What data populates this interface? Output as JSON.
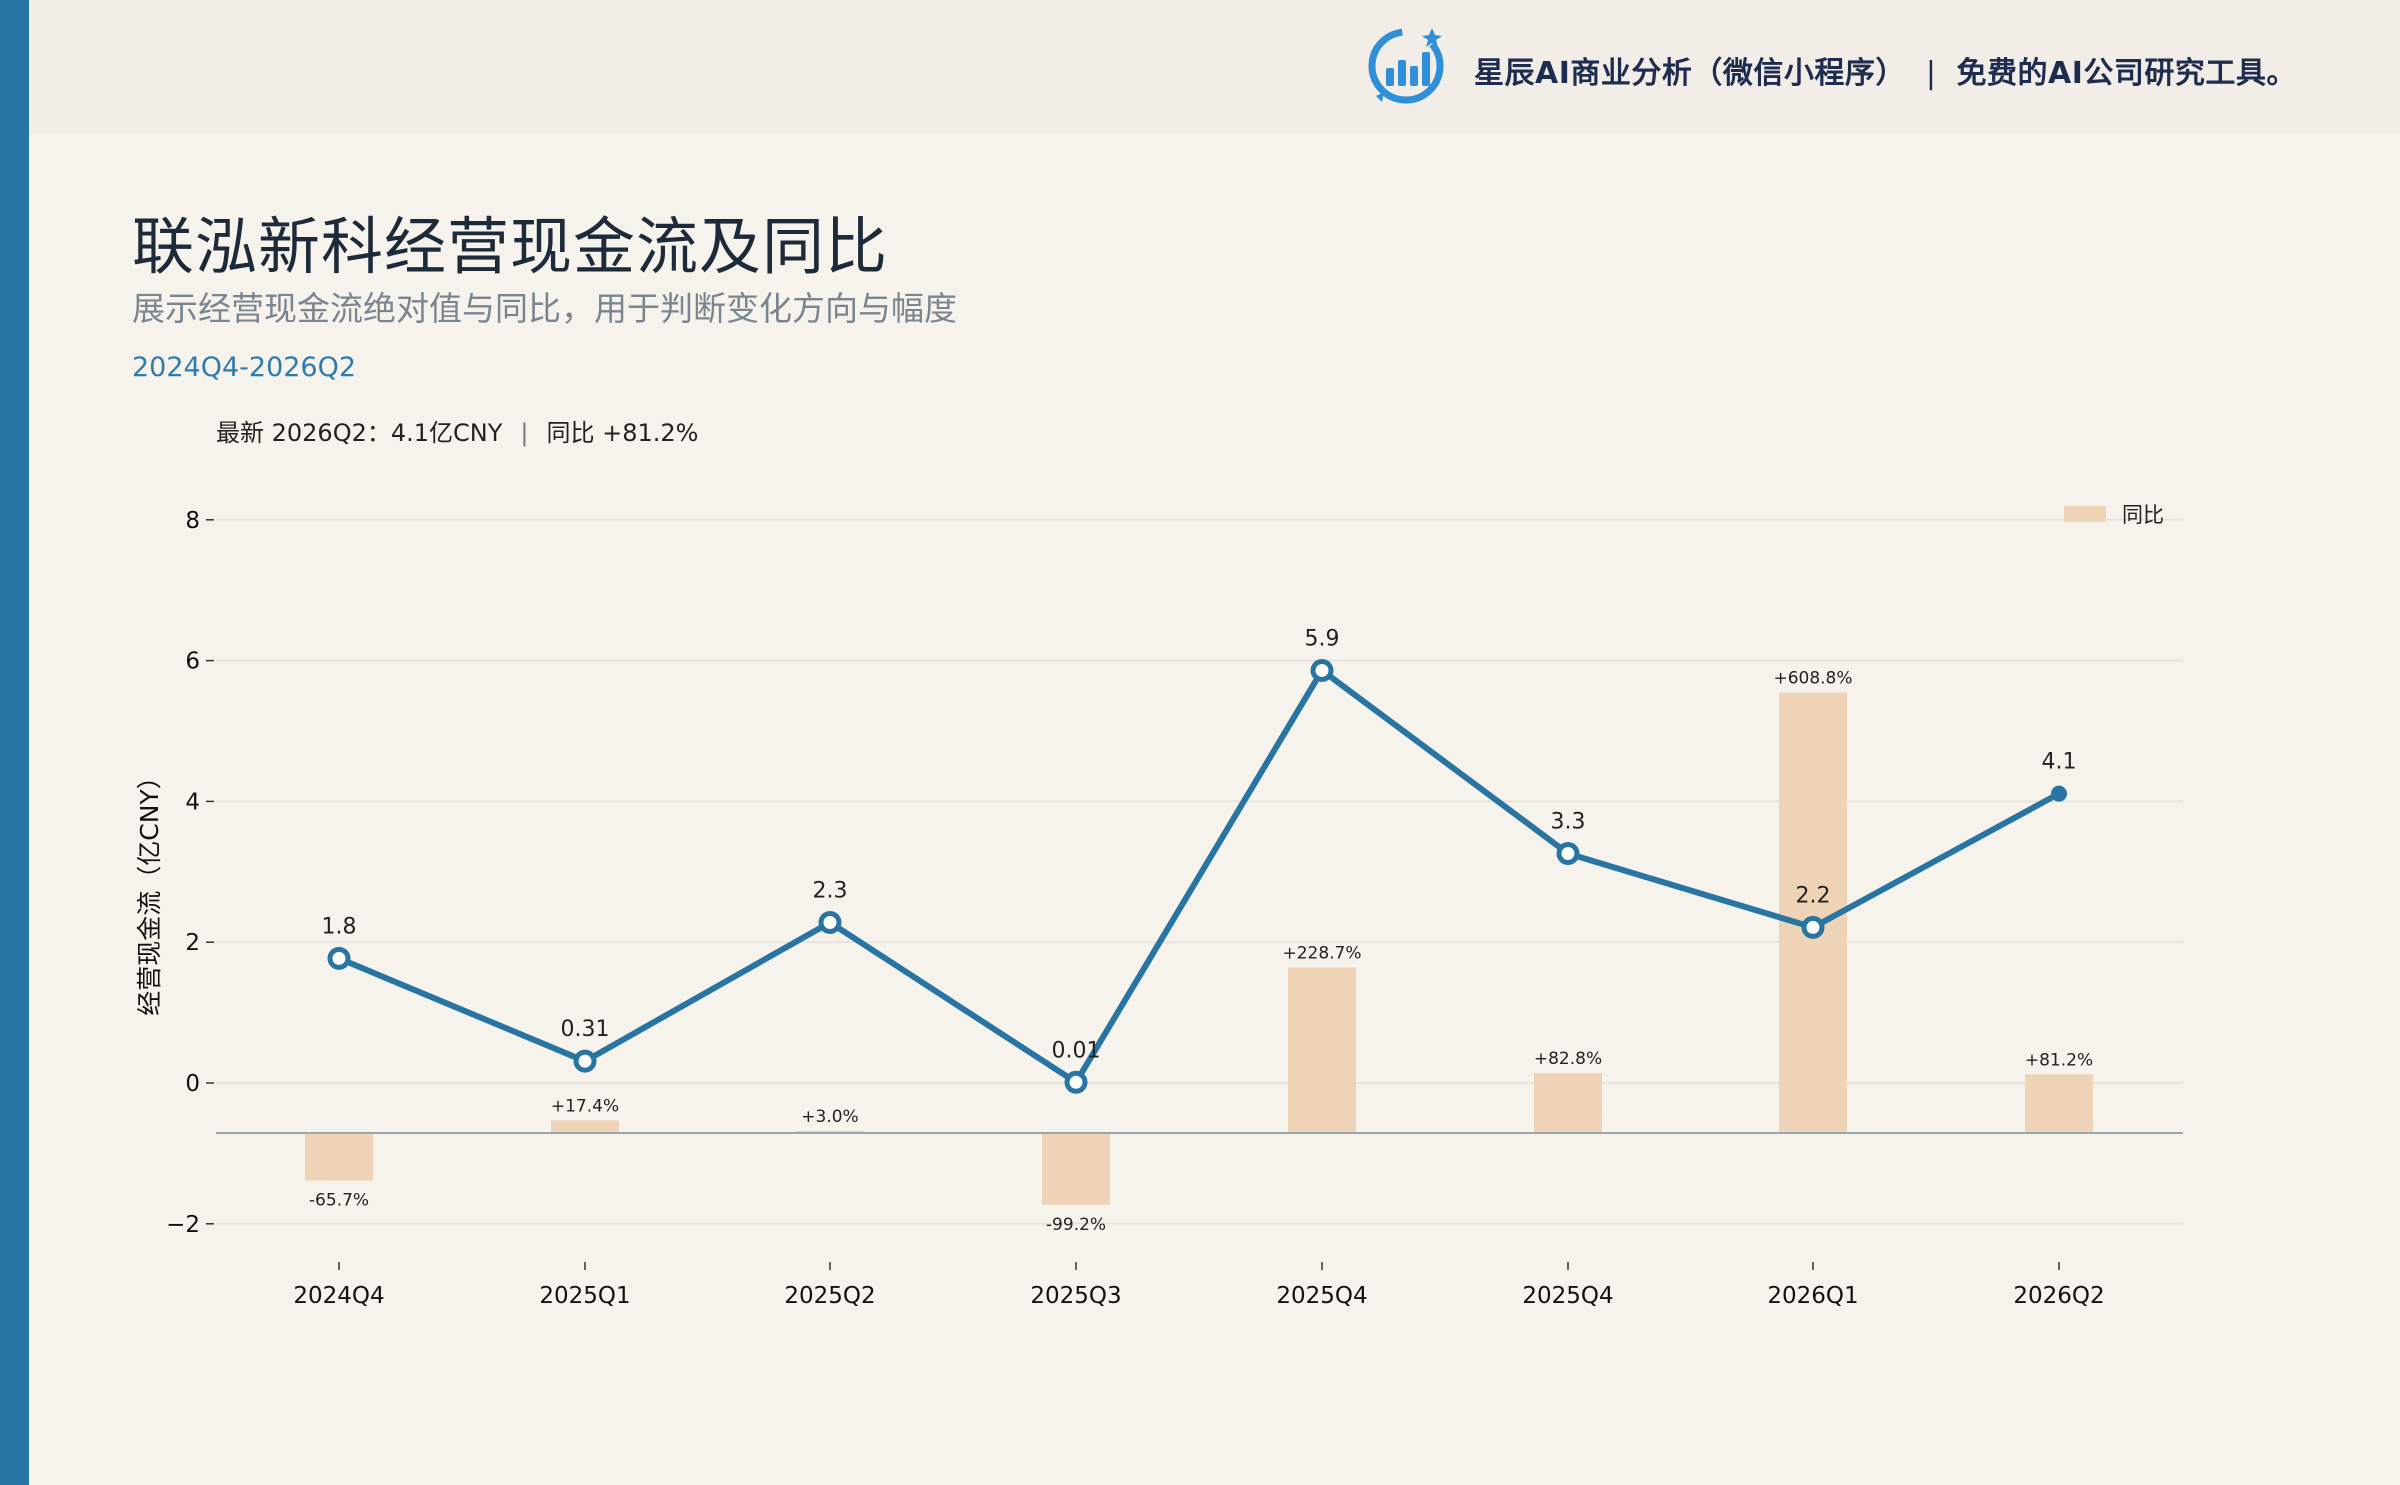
{
  "header": {
    "brand_name": "星辰AI商业分析（微信小程序）",
    "separator": "|",
    "brand_tagline": "免费的AI公司研究工具。",
    "logo_icon": "bar-chart-logo-icon"
  },
  "title": "联泓新科经营现金流及同比",
  "subtitle": "展示经营现金流绝对值与同比，用于判断变化方向与幅度",
  "period": "2024Q4-2026Q2",
  "latest": {
    "text": "最新 2026Q2：4.1亿CNY",
    "separator": "|",
    "yoy": "同比 +81.2%"
  },
  "colors": {
    "line": "#2874a2",
    "bar": "#efd3b6",
    "accent_stripe": "#2874a2",
    "background": "#f6f3ec"
  },
  "chart_data": {
    "type": "line",
    "categories": [
      "2024Q4",
      "2025Q1",
      "2025Q2",
      "2025Q3",
      "2025Q4",
      "2025Q4",
      "2026Q1",
      "2026Q2"
    ],
    "series": [
      {
        "values": [
          1.77,
          0.31,
          2.28,
          0.01,
          5.86,
          3.26,
          2.21,
          4.11
        ],
        "labels": [
          "1.8",
          "0.31",
          "2.3",
          "0.01",
          "5.9",
          "3.3",
          "2.2",
          "4.1"
        ]
      }
    ],
    "yoy": {
      "name": "同比",
      "values": [
        -65.7,
        17.4,
        3.0,
        -99.2,
        228.7,
        82.8,
        608.8,
        81.2
      ],
      "labels": [
        "-65.7%",
        "+17.4%",
        "+3.0%",
        "-99.2%",
        "+228.7%",
        "+82.8%",
        "+608.8%",
        "+81.2%"
      ]
    },
    "ylabel": "经营现金流（亿CNY）",
    "yticks": [
      -2,
      0,
      2,
      4,
      6,
      8
    ],
    "ytick_labels": [
      "−2",
      "0",
      "2",
      "4",
      "6",
      "8"
    ],
    "ylim": [
      -2.6,
      8.2
    ],
    "grid": true,
    "legend_position": "top-right"
  }
}
